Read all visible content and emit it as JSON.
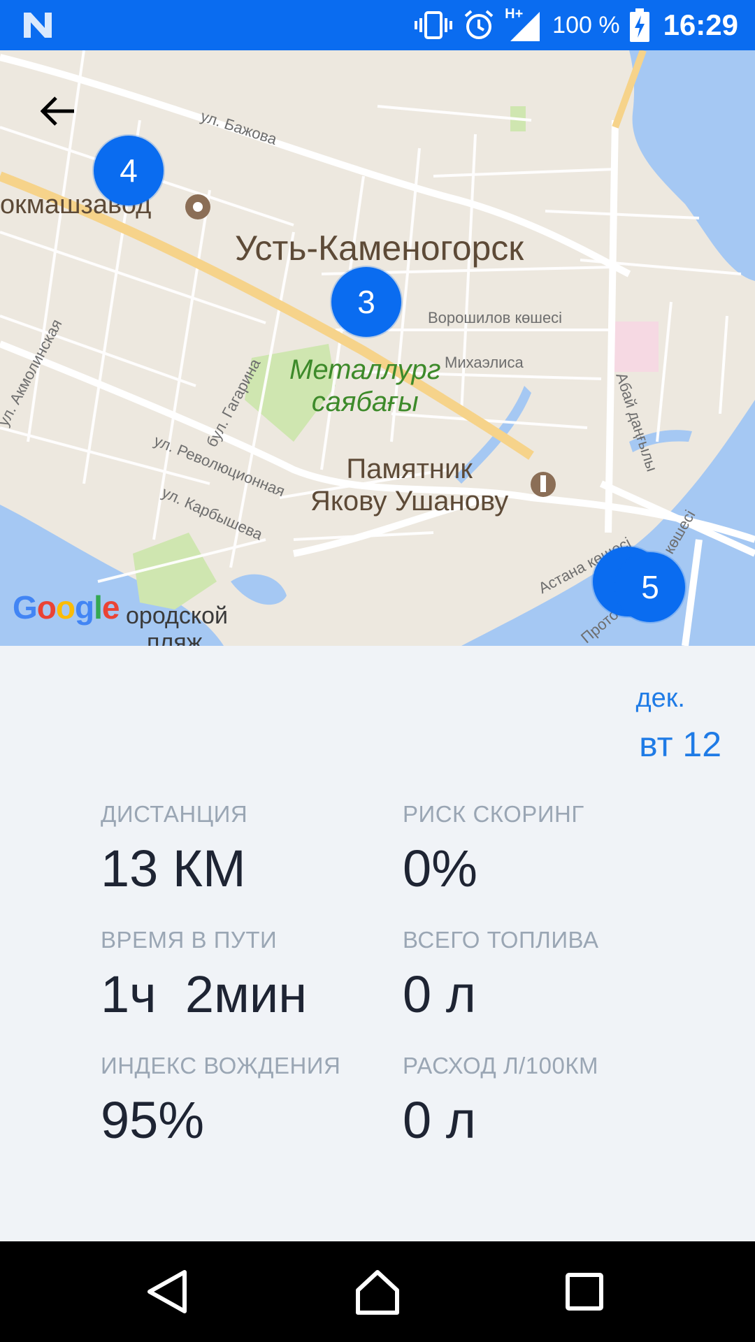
{
  "status_bar": {
    "network_type": "H+",
    "battery_percent": "100 %",
    "time": "16:29",
    "icons": [
      "notification-n-icon",
      "vibrate-icon",
      "alarm-icon",
      "signal-icon",
      "battery-charging-icon"
    ],
    "background_color": "#0a6cf0"
  },
  "map": {
    "city_label": "Усть-Каменогорск",
    "poi_left": "окмашзавод",
    "park_label_line1": "Металлург",
    "park_label_line2": "саябағы",
    "monument_line1": "Памятник",
    "monument_line2": "Якову Ушанову",
    "beach_line1": "ородской",
    "beach_line2": "пляж",
    "streets": {
      "bazhova": "ул. Бажова",
      "voroshilov": "Ворошилов көшесі",
      "mikhaelisa": "Михаэлиса",
      "akmolinskaya": "ул. Акмолинская",
      "gagarina": "бул. Гагарина",
      "revolyutsionnaya": "ул. Революционная",
      "karbysheva": "ул. Карбышева",
      "abai": "Абай даңғылы",
      "astana": "Астана көшесі",
      "proto": "Прото",
      "kosh": "көшесі"
    },
    "markers": [
      "4",
      "3",
      "5"
    ],
    "google_logo": "Google",
    "marker_color": "#0a6cf0"
  },
  "trip": {
    "date_month": "дек.",
    "date_day": "вт 12",
    "stats": [
      {
        "label": "ДИСТАНЦИЯ",
        "value": "13 КМ"
      },
      {
        "label": "РИСК СКОРИНГ",
        "value": "0%"
      },
      {
        "label": "ВРЕМЯ В ПУТИ",
        "value": "1ч  2мин"
      },
      {
        "label": "ВСЕГО ТОПЛИВА",
        "value": "0 л"
      },
      {
        "label": "ИНДЕКС ВОЖДЕНИЯ",
        "value": "95%"
      },
      {
        "label": "РАСХОД Л/100КМ",
        "value": "0 л"
      }
    ],
    "accent_color": "#1f7be6"
  },
  "nav_bar": {
    "icons": [
      "back-triangle-icon",
      "home-icon",
      "recents-icon"
    ]
  }
}
